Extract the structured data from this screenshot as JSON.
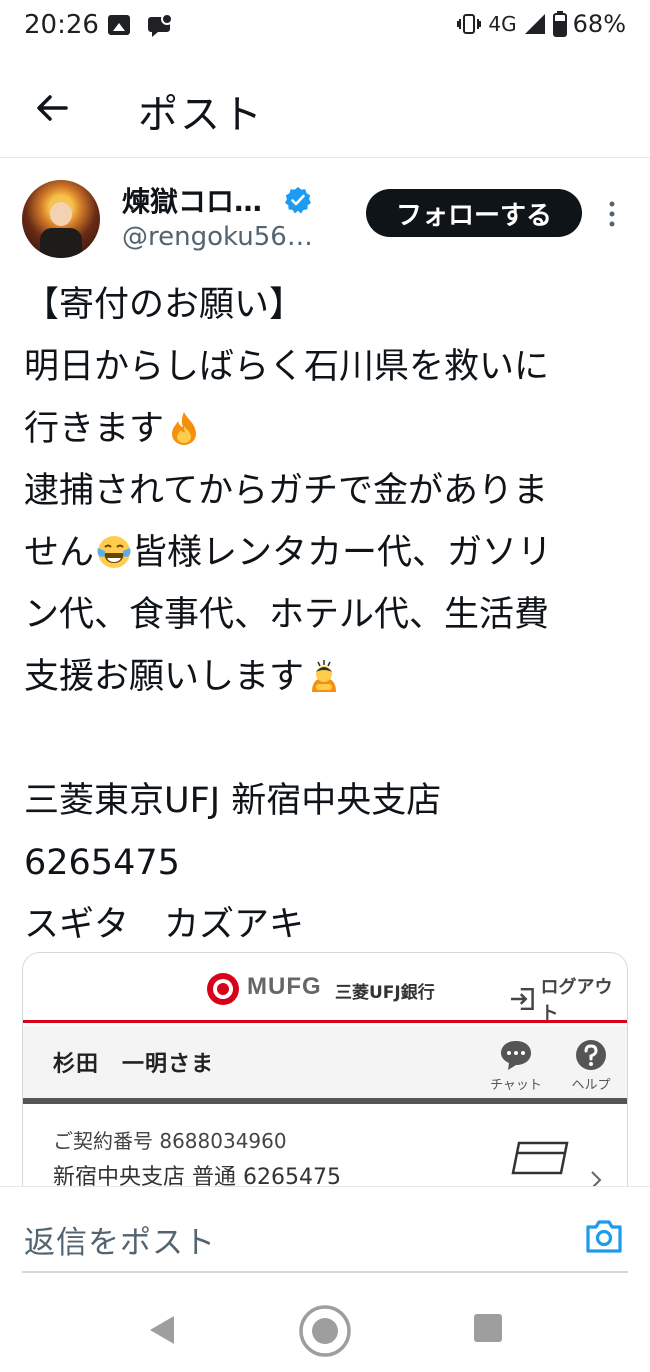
{
  "status_bar": {
    "time": "20:26",
    "network": "4G",
    "battery": "68%"
  },
  "header": {
    "title": "ポスト"
  },
  "post": {
    "author_name": "煉獄コロ…",
    "author_handle": "@rengoku56…",
    "follow_label": "フォローする",
    "lines": [
      "【寄付のお願い】",
      "明日からしばらく石川県を救いに",
      "行きます",
      "逮捕されてからガチで金がありま",
      "せん",
      "皆様レンタカー代、ガソリ",
      "ン代、食事代、ホテル代、生活費",
      "支援お願いします",
      "三菱東京UFJ 新宿中央支店",
      "6265475",
      "スギタ　カズアキ"
    ]
  },
  "embed": {
    "logo_text": "MUFG",
    "bank_name": "三菱UFJ銀行",
    "logout_label": "ログアウト",
    "user_name": "杉田　一明さま",
    "chat_label": "チャット",
    "help_label": "ヘルプ",
    "contract_line": "ご契約番号 8688034960",
    "account_line": "新宿中央支店 普通 6265475"
  },
  "reply": {
    "placeholder": "返信をポスト"
  },
  "colors": {
    "accent": "#1d9bf0",
    "mufg_red": "#d9001b",
    "text_secondary": "#536471"
  }
}
